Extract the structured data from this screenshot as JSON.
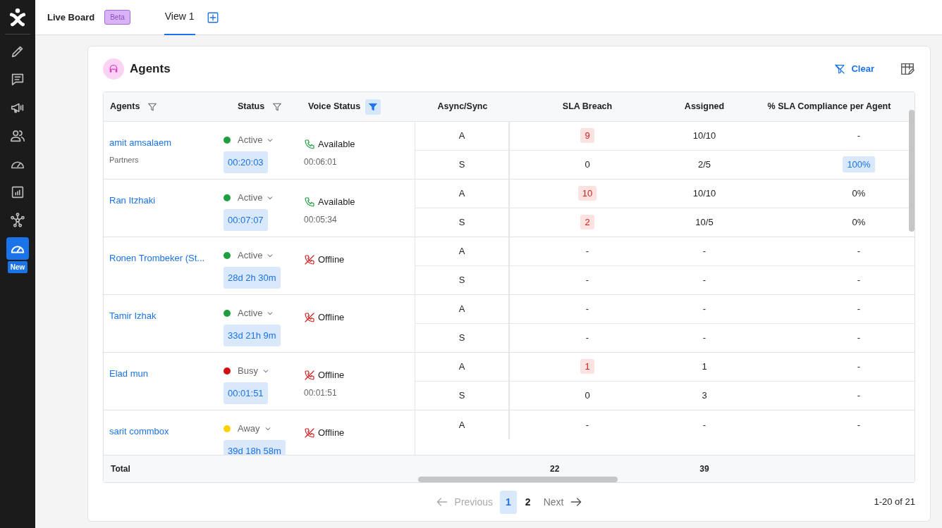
{
  "sidebar": {
    "items": [
      {
        "selected": false
      },
      {
        "selected": false
      },
      {
        "selected": false
      },
      {
        "selected": false
      },
      {
        "selected": false
      },
      {
        "selected": false
      },
      {
        "selected": false
      },
      {
        "selected": true,
        "badge": "New"
      }
    ]
  },
  "header": {
    "title": "Live Board",
    "badge": "Beta",
    "tabs": [
      {
        "label": "View 1",
        "selected": true
      }
    ]
  },
  "card": {
    "title": "Agents",
    "clear": "Clear"
  },
  "table": {
    "columns": [
      {
        "label": "Agents",
        "filterable": true,
        "filtered": false
      },
      {
        "label": "Status",
        "filterable": true,
        "filtered": false
      },
      {
        "label": "Voice Status",
        "filterable": true,
        "filtered": true
      },
      {
        "label": "Async/Sync"
      },
      {
        "label": "SLA Breach"
      },
      {
        "label": "Assigned"
      },
      {
        "label": "% SLA Compliance per Agent"
      }
    ],
    "rows": [
      {
        "name": "amit amsalaem",
        "team": "Partners",
        "status": {
          "label": "Active",
          "color": "#1e9e3e"
        },
        "duration": "00:20:03",
        "voice": {
          "label": "Available",
          "kind": "available",
          "time": "00:06:01"
        },
        "sub": [
          {
            "mode": "A",
            "sla": "9",
            "breach": true,
            "assigned": "10/10",
            "compliance": "-",
            "highlight": false
          },
          {
            "mode": "S",
            "sla": "0",
            "breach": false,
            "assigned": "2/5",
            "compliance": "100%",
            "highlight": true
          }
        ]
      },
      {
        "name": "Ran Itzhaki",
        "status": {
          "label": "Active",
          "color": "#1e9e3e"
        },
        "duration": "00:07:07",
        "voice": {
          "label": "Available",
          "kind": "available",
          "time": "00:05:34"
        },
        "sub": [
          {
            "mode": "A",
            "sla": "10",
            "breach": true,
            "assigned": "10/10",
            "compliance": "0%",
            "highlight": false
          },
          {
            "mode": "S",
            "sla": "2",
            "breach": true,
            "assigned": "10/5",
            "compliance": "0%",
            "highlight": false
          }
        ]
      },
      {
        "name": "Ronen Trombeker (St...",
        "status": {
          "label": "Active",
          "color": "#1e9e3e"
        },
        "duration": "28d 2h 30m",
        "voice": {
          "label": "Offline",
          "kind": "offline"
        },
        "sub": [
          {
            "mode": "A",
            "sla": "-",
            "breach": false,
            "assigned": "-",
            "compliance": "-",
            "highlight": false
          },
          {
            "mode": "S",
            "sla": "-",
            "breach": false,
            "assigned": "-",
            "compliance": "-",
            "highlight": false
          }
        ]
      },
      {
        "name": "Tamir Izhak",
        "status": {
          "label": "Active",
          "color": "#1e9e3e"
        },
        "duration": "33d 21h 9m",
        "voice": {
          "label": "Offline",
          "kind": "offline"
        },
        "sub": [
          {
            "mode": "A",
            "sla": "-",
            "breach": false,
            "assigned": "-",
            "compliance": "-",
            "highlight": false
          },
          {
            "mode": "S",
            "sla": "-",
            "breach": false,
            "assigned": "-",
            "compliance": "-",
            "highlight": false
          }
        ]
      },
      {
        "name": "Elad mun",
        "status": {
          "label": "Busy",
          "color": "#d10f0f"
        },
        "duration": "00:01:51",
        "voice": {
          "label": "Offline",
          "kind": "offline",
          "time": "00:01:51"
        },
        "sub": [
          {
            "mode": "A",
            "sla": "1",
            "breach": true,
            "assigned": "1",
            "compliance": "-",
            "highlight": false
          },
          {
            "mode": "S",
            "sla": "0",
            "breach": false,
            "assigned": "3",
            "compliance": "-",
            "highlight": false
          }
        ]
      },
      {
        "name": "sarit commbox",
        "status": {
          "label": "Away",
          "color": "#ffd000"
        },
        "duration": "39d 18h 58m",
        "voice": {
          "label": "Offline",
          "kind": "offline"
        },
        "sub": [
          {
            "mode": "A",
            "sla": "-",
            "breach": false,
            "assigned": "-",
            "compliance": "-",
            "highlight": false
          }
        ]
      }
    ],
    "totals": {
      "label": "Total",
      "sla": "22",
      "assigned": "39"
    }
  },
  "pagination": {
    "previous": "Previous",
    "previous_disabled": true,
    "pages": [
      {
        "label": "1",
        "selected": true
      },
      {
        "label": "2",
        "selected": false
      }
    ],
    "next": "Next",
    "range": "1-20 of 21"
  }
}
